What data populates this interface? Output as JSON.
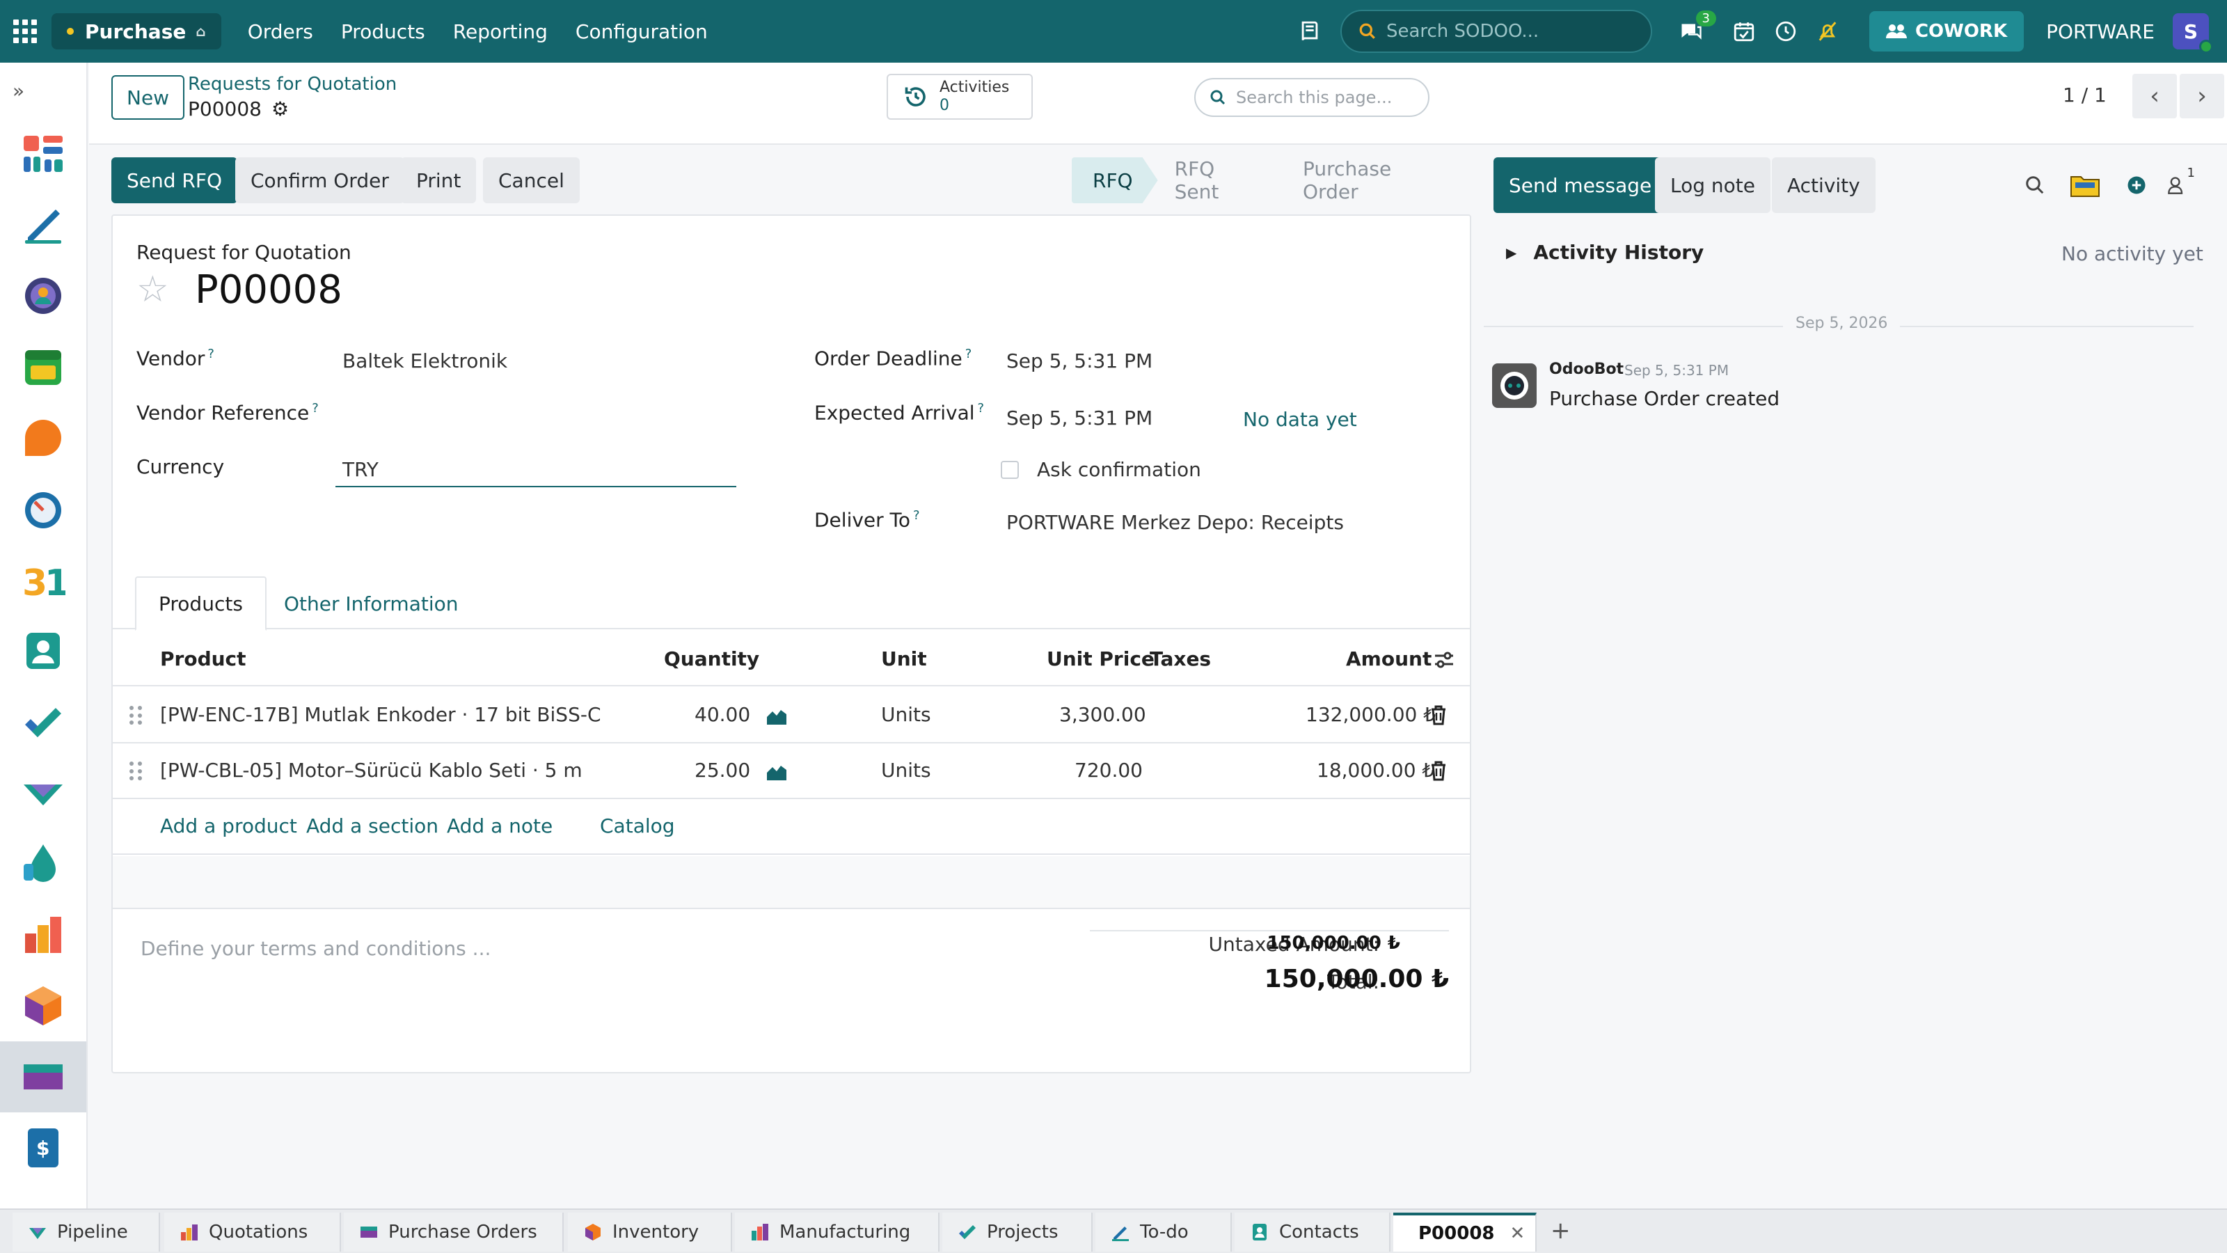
{
  "navbar": {
    "app_name": "Purchase",
    "menu": [
      "Orders",
      "Products",
      "Reporting",
      "Configuration"
    ],
    "search_placeholder": "Search SODOO...",
    "chat_badge": "3",
    "cowork_label": "COWORK",
    "company": "PORTWARE",
    "avatar_letter": "S"
  },
  "control": {
    "new_label": "New",
    "breadcrumb_parent": "Requests for Quotation",
    "breadcrumb_current": "P00008",
    "activities_label": "Activities",
    "activities_count": "0",
    "page_search_placeholder": "Search this page...",
    "pager": "1 / 1"
  },
  "form": {
    "buttons": [
      "Send RFQ",
      "Confirm Order",
      "Print",
      "Cancel"
    ],
    "stages": [
      "RFQ",
      "RFQ Sent",
      "Purchase Order"
    ],
    "active_stage": "RFQ",
    "title_label": "Request for Quotation",
    "name": "P00008",
    "vendor_label": "Vendor",
    "vendor": "Baltek Elektronik",
    "vendor_ref_label": "Vendor Reference",
    "currency_label": "Currency",
    "currency": "TRY",
    "order_deadline_label": "Order Deadline",
    "order_deadline": "Sep 5, 5:31 PM",
    "expected_arrival_label": "Expected Arrival",
    "expected_arrival": "Sep 5, 5:31 PM",
    "no_data": "No data yet",
    "ask_confirmation": "Ask confirmation",
    "deliver_to_label": "Deliver To",
    "deliver_to": "PORTWARE Merkez Depo: Receipts",
    "help_mark": "?",
    "tabs": [
      "Products",
      "Other Information"
    ],
    "columns": [
      "Product",
      "Quantity",
      "Unit",
      "Unit Price",
      "Taxes",
      "Amount"
    ],
    "lines": [
      {
        "product": "[PW-ENC-17B] Mutlak Enkoder · 17 bit BiSS-C",
        "qty": "40.00",
        "unit": "Units",
        "price": "3,300.00",
        "amount": "132,000.00 ₺"
      },
      {
        "product": "[PW-CBL-05] Motor–Sürücü Kablo Seti · 5 m",
        "qty": "25.00",
        "unit": "Units",
        "price": "720.00",
        "amount": "18,000.00 ₺"
      }
    ],
    "add_links": [
      "Add a product",
      "Add a section",
      "Add a note",
      "Catalog"
    ],
    "terms_placeholder": "Define your terms and conditions ...",
    "untaxed_label": "Untaxed Amount:",
    "untaxed_value": "150,000.00 ₺",
    "total_label": "Total:",
    "total_value": "150,000.00 ₺"
  },
  "chatter": {
    "send_message": "Send message",
    "log_note": "Log note",
    "activity": "Activity",
    "followers_count": "1",
    "activity_history": "Activity History",
    "no_activity": "No activity yet",
    "date_separator": "Sep 5, 2026",
    "author": "OdooBot",
    "time": "Sep 5, 5:31 PM",
    "message": "Purchase Order created"
  },
  "bottom_tabs": [
    "Pipeline",
    "Quotations",
    "Purchase Orders",
    "Inventory",
    "Manufacturing",
    "Projects",
    "To-do",
    "Contacts",
    "P00008"
  ],
  "colors": {
    "brand": "#14656c",
    "accent": "#28a745"
  }
}
